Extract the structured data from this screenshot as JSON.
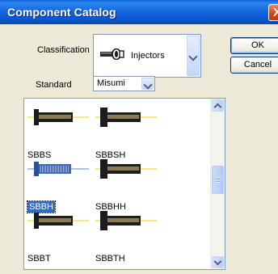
{
  "window": {
    "title": "Component Catalog",
    "close_glyph": "X"
  },
  "classification": {
    "label": "Classification",
    "value": "Injectors",
    "icon": "injector-icon"
  },
  "standard": {
    "label": "Standard",
    "value": "Misumi"
  },
  "buttons": {
    "ok": "OK",
    "cancel": "Cancel"
  },
  "catalog": {
    "items": [
      {
        "name": "SBBS",
        "selected": false
      },
      {
        "name": "SBBSH",
        "selected": false
      },
      {
        "name": "SBBH",
        "selected": true
      },
      {
        "name": "SBBHH",
        "selected": false
      },
      {
        "name": "SBBT",
        "selected": false
      },
      {
        "name": "SBBTH",
        "selected": false
      }
    ]
  },
  "colors": {
    "selection": "#316AC5",
    "title_bar": "#0A5FD6",
    "icon_metal": "#8C7A50",
    "icon_dark": "#1C1C1C",
    "icon_selected_body": "#3E6CC4",
    "centerline": "#E6D21E"
  }
}
